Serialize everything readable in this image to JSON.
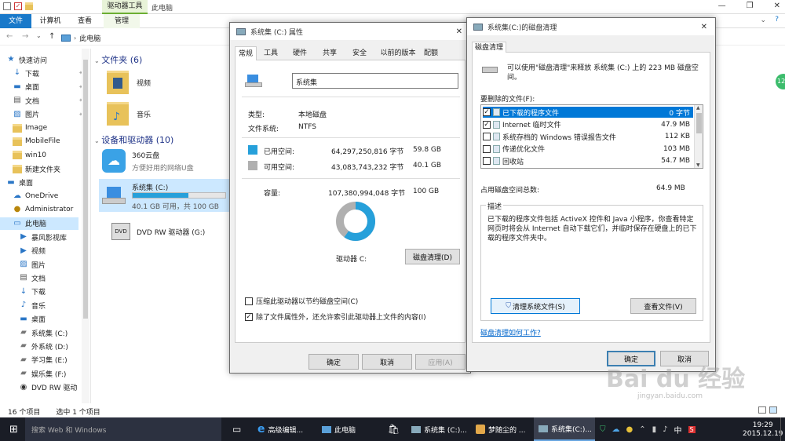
{
  "ribbon": {
    "context_tool": "驱动器工具",
    "window_title": "此电脑",
    "tabs": [
      "文件",
      "计算机",
      "查看",
      "管理"
    ]
  },
  "address": {
    "path": "此电脑"
  },
  "nav": {
    "items": [
      {
        "label": "快速访问",
        "icon": "star-icon"
      },
      {
        "label": "下载",
        "icon": "download-icon"
      },
      {
        "label": "桌面",
        "icon": "desktop-icon"
      },
      {
        "label": "文档",
        "icon": "document-icon"
      },
      {
        "label": "图片",
        "icon": "picture-icon"
      },
      {
        "label": "Image",
        "icon": "folder-icon"
      },
      {
        "label": "MobileFile",
        "icon": "folder-icon"
      },
      {
        "label": "win10",
        "icon": "folder-icon"
      },
      {
        "label": "新建文件夹",
        "icon": "folder-icon"
      },
      {
        "label": "桌面",
        "icon": "desktop-icon"
      },
      {
        "label": "OneDrive",
        "icon": "cloud-icon"
      },
      {
        "label": "Administrator",
        "icon": "user-icon"
      },
      {
        "label": "此电脑",
        "icon": "computer-icon"
      },
      {
        "label": "暴风影视库",
        "icon": "video-icon"
      },
      {
        "label": "视频",
        "icon": "video-icon"
      },
      {
        "label": "图片",
        "icon": "picture-icon"
      },
      {
        "label": "文档",
        "icon": "document-icon"
      },
      {
        "label": "下载",
        "icon": "download-icon"
      },
      {
        "label": "音乐",
        "icon": "music-icon"
      },
      {
        "label": "桌面",
        "icon": "desktop-icon"
      },
      {
        "label": "系统集 (C:)",
        "icon": "drive-icon"
      },
      {
        "label": "外系统 (D:)",
        "icon": "drive-icon"
      },
      {
        "label": "学习集 (E:)",
        "icon": "drive-icon"
      },
      {
        "label": "娱乐集 (F:)",
        "icon": "drive-icon"
      },
      {
        "label": "DVD RW 驱动",
        "icon": "dvd-icon"
      }
    ]
  },
  "content": {
    "folders_header": "文件夹 (6)",
    "folders": [
      "视频",
      "音乐"
    ],
    "devices_header": "设备和驱动器 (10)",
    "cloud": {
      "name": "360云盘",
      "desc": "方便好用的网络U盘"
    },
    "drive_c": {
      "name": "系统集 (C:)",
      "space": "40.1 GB 可用，共 100 GB",
      "used_fraction": 0.598
    },
    "dvd": {
      "name": "DVD RW 驱动器 (G:)"
    }
  },
  "status": {
    "items": "16 个项目",
    "selected": "选中 1 个项目"
  },
  "props": {
    "title": "系统集 (C:) 属性",
    "tabs": [
      "常规",
      "工具",
      "硬件",
      "共享",
      "安全",
      "以前的版本",
      "配额"
    ],
    "name": "系统集",
    "type_label": "类型:",
    "type": "本地磁盘",
    "fs_label": "文件系统:",
    "fs": "NTFS",
    "used_label": "已用空间:",
    "used_bytes": "64,297,250,816 字节",
    "used_gb": "59.8 GB",
    "free_label": "可用空间:",
    "free_bytes": "43,083,743,232 字节",
    "free_gb": "40.1 GB",
    "cap_label": "容量:",
    "cap_bytes": "107,380,994,048 字节",
    "cap_gb": "100 GB",
    "drive_label": "驱动器 C:",
    "cleanup_btn": "磁盘清理(D)",
    "compress": "压缩此驱动器以节约磁盘空间(C)",
    "index": "除了文件属性外，还允许索引此驱动器上文件的内容(I)",
    "ok": "确定",
    "cancel": "取消",
    "apply": "应用(A)",
    "used_color": "#26a0da",
    "free_color": "#b0b0b0"
  },
  "cleanup": {
    "title": "系统集(C:)的磁盘清理",
    "tab": "磁盘清理",
    "intro": "可以使用\"磁盘清理\"来释放 系统集 (C:) 上的 223 MB 磁盘空间。",
    "files_label": "要删除的文件(F):",
    "files": [
      {
        "name": "已下载的程序文件",
        "size": "0 字节",
        "checked": true,
        "selected": true
      },
      {
        "name": "Internet 临时文件",
        "size": "47.9 MB",
        "checked": true,
        "selected": false
      },
      {
        "name": "系统存档的 Windows 错误报告文件",
        "size": "112 KB",
        "checked": false,
        "selected": false
      },
      {
        "name": "传递优化文件",
        "size": "103 MB",
        "checked": false,
        "selected": false
      },
      {
        "name": "回收站",
        "size": "54.7 MB",
        "checked": false,
        "selected": false
      }
    ],
    "total_label": "占用磁盘空间总数:",
    "total": "64.9 MB",
    "desc_label": "描述",
    "desc": "已下载的程序文件包括 ActiveX 控件和 Java 小程序，你查看特定网页时将会从 Internet 自动下载它们，并临时保存在硬盘上的已下载的程序文件夹中。",
    "clean_sys": "清理系统文件(S)",
    "view_files": "查看文件(V)",
    "link": "磁盘清理如何工作?",
    "ok": "确定",
    "cancel": "取消"
  },
  "taskbar": {
    "search": "搜索 Web 和 Windows",
    "apps": [
      "高级编辑...",
      "此电脑",
      "系统集 (C:)...",
      "梦随尘的 ...",
      "系统集(C:)..."
    ],
    "time": "19:29",
    "date": "2015.12.19",
    "ime": "中"
  },
  "watermark": {
    "text": "Bai du 经验",
    "sub": "jingyan.baidu.com"
  },
  "badge": "12"
}
